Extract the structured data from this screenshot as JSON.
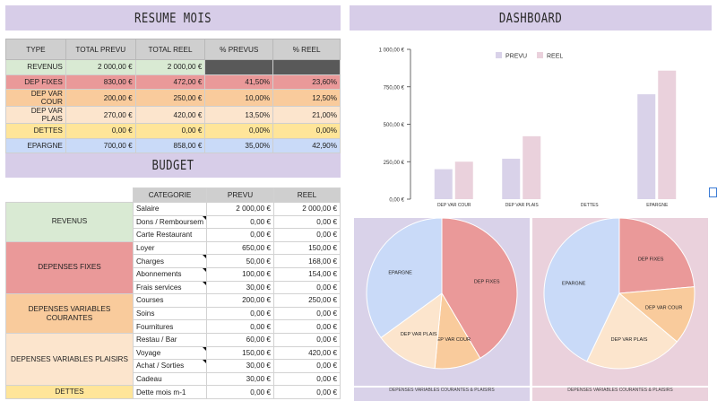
{
  "resume": {
    "title": "RESUME MOIS",
    "headers": [
      "TYPE",
      "TOTAL PREVU",
      "TOTAL REEL",
      "% PREVUS",
      "% REEL"
    ],
    "rows": [
      {
        "type": "REVENUS",
        "prevu": "2 000,00 €",
        "reel": "2 000,00 €",
        "pct_prevu": "",
        "pct_reel": "",
        "color": "#d9ead3"
      },
      {
        "type": "DEP FIXES",
        "prevu": "830,00 €",
        "reel": "472,00 €",
        "pct_prevu": "41,50%",
        "pct_reel": "23,60%",
        "color": "#ea9999"
      },
      {
        "type": "DEP VAR COUR",
        "prevu": "200,00 €",
        "reel": "250,00 €",
        "pct_prevu": "10,00%",
        "pct_reel": "12,50%",
        "color": "#f9cb9c"
      },
      {
        "type": "DEP VAR PLAIS",
        "prevu": "270,00 €",
        "reel": "420,00 €",
        "pct_prevu": "13,50%",
        "pct_reel": "21,00%",
        "color": "#fce5cd"
      },
      {
        "type": "DETTES",
        "prevu": "0,00 €",
        "reel": "0,00 €",
        "pct_prevu": "0,00%",
        "pct_reel": "0,00%",
        "color": "#ffe599"
      },
      {
        "type": "EPARGNE",
        "prevu": "700,00 €",
        "reel": "858,00 €",
        "pct_prevu": "35,00%",
        "pct_reel": "42,90%",
        "color": "#c9daf8"
      }
    ]
  },
  "budget": {
    "title": "BUDGET",
    "headers": [
      "CATEGORIE",
      "PREVU",
      "REEL"
    ],
    "groups": [
      {
        "label": "REVENUS",
        "color": "#d9ead3",
        "items": [
          {
            "cat": "Salaire",
            "prevu": "2 000,00 €",
            "reel": "2 000,00 €",
            "note": false
          },
          {
            "cat": "Dons / Remboursem",
            "prevu": "0,00 €",
            "reel": "0,00 €",
            "note": true
          },
          {
            "cat": "Carte Restaurant",
            "prevu": "0,00 €",
            "reel": "0,00 €",
            "note": false
          }
        ]
      },
      {
        "label": "DEPENSES FIXES",
        "color": "#ea9999",
        "items": [
          {
            "cat": "Loyer",
            "prevu": "650,00 €",
            "reel": "150,00 €",
            "note": false
          },
          {
            "cat": "Charges",
            "prevu": "50,00 €",
            "reel": "168,00 €",
            "note": true
          },
          {
            "cat": "Abonnements",
            "prevu": "100,00 €",
            "reel": "154,00 €",
            "note": true
          },
          {
            "cat": "Frais services",
            "prevu": "30,00 €",
            "reel": "0,00 €",
            "note": true
          }
        ]
      },
      {
        "label": "DEPENSES VARIABLES COURANTES",
        "color": "#f9cb9c",
        "items": [
          {
            "cat": "Courses",
            "prevu": "200,00 €",
            "reel": "250,00 €",
            "note": false
          },
          {
            "cat": "Soins",
            "prevu": "0,00 €",
            "reel": "0,00 €",
            "note": false
          },
          {
            "cat": "Fournitures",
            "prevu": "0,00 €",
            "reel": "0,00 €",
            "note": false
          }
        ]
      },
      {
        "label": "DEPENSES VARIABLES PLAISIRS",
        "color": "#fce5cd",
        "items": [
          {
            "cat": "Restau / Bar",
            "prevu": "60,00 €",
            "reel": "0,00 €",
            "note": false
          },
          {
            "cat": "Voyage",
            "prevu": "150,00 €",
            "reel": "420,00 €",
            "note": true
          },
          {
            "cat": "Achat / Sorties",
            "prevu": "30,00 €",
            "reel": "0,00 €",
            "note": true
          },
          {
            "cat": "Cadeau",
            "prevu": "30,00 €",
            "reel": "0,00 €",
            "note": false
          }
        ]
      },
      {
        "label": "DETTES",
        "color": "#ffe599",
        "items": [
          {
            "cat": "Dette mois m-1",
            "prevu": "0,00 €",
            "reel": "0,00 €",
            "note": false
          }
        ]
      }
    ]
  },
  "dashboard": {
    "title": "DASHBOARD",
    "bottom_strip_left": "DEPENSES VARIABLES COURANTES & PLAISIRS",
    "bottom_strip_right": "DEPENSES VARIABLES COURANTES & PLAISIRS"
  },
  "chart_data": [
    {
      "type": "bar",
      "categories": [
        "DEP VAR COUR",
        "DEP VAR PLAIS",
        "DETTES",
        "EPARGNE"
      ],
      "series": [
        {
          "name": "PREVU",
          "values": [
            200,
            270,
            0,
            700
          ],
          "color": "#d9d2e9"
        },
        {
          "name": "REEL",
          "values": [
            250,
            420,
            0,
            858
          ],
          "color": "#ead1dc"
        }
      ],
      "yticks": [
        "0,00 €",
        "250,00 €",
        "500,00 €",
        "750,00 €",
        "1 000,00 €"
      ],
      "ylim": [
        0,
        1000
      ],
      "legend": "top"
    },
    {
      "type": "pie",
      "slices": [
        {
          "label": "DEP FIXES",
          "value": 830,
          "color": "#ea9999"
        },
        {
          "label": "DEP VAR COUR",
          "value": 200,
          "color": "#f9cb9c"
        },
        {
          "label": "DEP VAR PLAIS",
          "value": 270,
          "color": "#fce5cd"
        },
        {
          "label": "EPARGNE",
          "value": 700,
          "color": "#c9daf8"
        }
      ],
      "background": "#d9d2e9"
    },
    {
      "type": "pie",
      "slices": [
        {
          "label": "DEP FIXES",
          "value": 472,
          "color": "#ea9999"
        },
        {
          "label": "DEP VAR COUR",
          "value": 250,
          "color": "#f9cb9c"
        },
        {
          "label": "DEP VAR PLAIS",
          "value": 420,
          "color": "#fce5cd"
        },
        {
          "label": "EPARGNE",
          "value": 858,
          "color": "#c9daf8"
        }
      ],
      "background": "#ead1dc"
    }
  ]
}
